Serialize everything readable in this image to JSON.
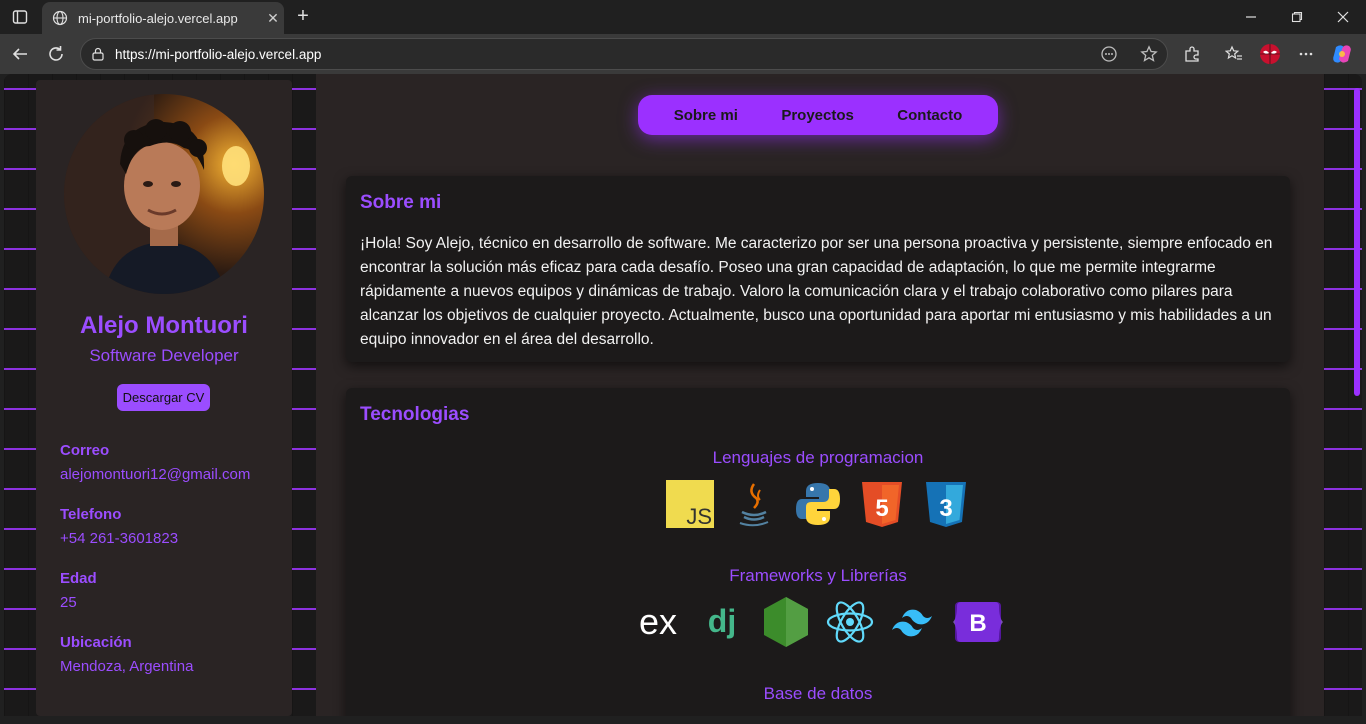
{
  "browser": {
    "tab_title": "mi-portfolio-alejo.vercel.app",
    "url": "https://mi-portfolio-alejo.vercel.app",
    "new_tab_symbol": "+",
    "close_symbol": "✕"
  },
  "profile": {
    "name": "Alejo Montuori",
    "role": "Software Developer",
    "cv_button": "Descargar CV",
    "info": [
      {
        "label": "Correo",
        "value": "alejomontuori12@gmail.com"
      },
      {
        "label": "Telefono",
        "value": "+54 261-3601823"
      },
      {
        "label": "Edad",
        "value": "25"
      },
      {
        "label": "Ubicación",
        "value": "Mendoza, Argentina"
      }
    ]
  },
  "nav": {
    "items": [
      "Sobre mi",
      "Proyectos",
      "Contacto"
    ]
  },
  "about": {
    "title": "Sobre mi",
    "text": "¡Hola! Soy Alejo, técnico en desarrollo de software. Me caracterizo por ser una persona proactiva y persistente, siempre enfocado en encontrar la solución más eficaz para cada desafío. Poseo una gran capacidad de adaptación, lo que me permite integrarme rápidamente a nuevos equipos y dinámicas de trabajo. Valoro la comunicación clara y el trabajo colaborativo como pilares para alcanzar los objetivos de cualquier proyecto. Actualmente, busco una oportunidad para aportar mi entusiasmo y mis habilidades a un equipo innovador en el área del desarrollo."
  },
  "tech": {
    "title": "Tecnologias",
    "groups": [
      {
        "title": "Lenguajes de programacion",
        "icons": [
          "javascript-icon",
          "java-icon",
          "python-icon",
          "html5-icon",
          "css3-icon"
        ]
      },
      {
        "title": "Frameworks y Librerías",
        "icons": [
          "express-icon",
          "django-icon",
          "nodejs-icon",
          "react-icon",
          "tailwind-icon",
          "bootstrap-icon"
        ]
      },
      {
        "title": "Base de datos",
        "icons": []
      }
    ],
    "js_label": "JS",
    "html_label": "5",
    "css_label": "3",
    "express_label": "ex",
    "django_label": "dj",
    "bootstrap_label": "B"
  },
  "colors": {
    "accent": "#9b4dff",
    "nav_bg": "#9b30ff",
    "card_bg": "#1c1a1a",
    "panel_bg": "#2a2424"
  }
}
